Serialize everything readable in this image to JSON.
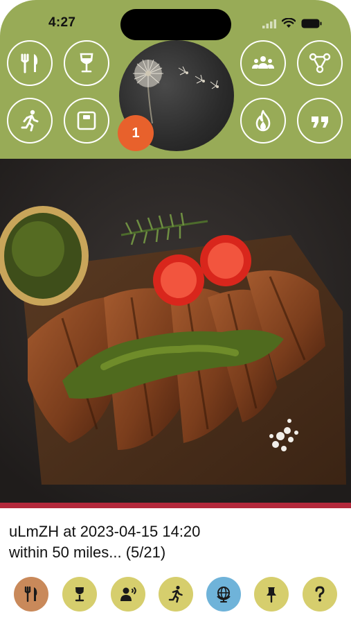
{
  "status_bar": {
    "time": "4:27"
  },
  "header": {
    "background_color": "#98ab57",
    "left_buttons": [
      {
        "icon": "utensils-icon"
      },
      {
        "icon": "wine-glass-icon"
      },
      {
        "icon": "running-person-icon"
      },
      {
        "icon": "scale-icon"
      }
    ],
    "right_buttons": [
      {
        "icon": "people-group-icon"
      },
      {
        "icon": "network-nodes-icon"
      },
      {
        "icon": "flame-icon"
      },
      {
        "icon": "quote-icon"
      }
    ],
    "avatar": {
      "icon": "dandelion-image"
    },
    "badge_count": "1"
  },
  "photo": {
    "subject": "food-photo"
  },
  "caption": {
    "line1": "uLmZH at 2023-04-15 14:20",
    "line2": "within 50 miles... (5/21)"
  },
  "bottom_bar": {
    "items": [
      {
        "icon": "utensils-icon",
        "color": "#c9895a"
      },
      {
        "icon": "wine-glass-icon",
        "color": "#d6ce6d"
      },
      {
        "icon": "speaking-person-icon",
        "color": "#d6ce6d"
      },
      {
        "icon": "running-person-icon",
        "color": "#d6ce6d"
      },
      {
        "icon": "globe-icon",
        "color": "#6fb3d9"
      },
      {
        "icon": "pin-icon",
        "color": "#d6ce6d"
      },
      {
        "icon": "question-mark-icon",
        "color": "#d6ce6d"
      }
    ]
  }
}
